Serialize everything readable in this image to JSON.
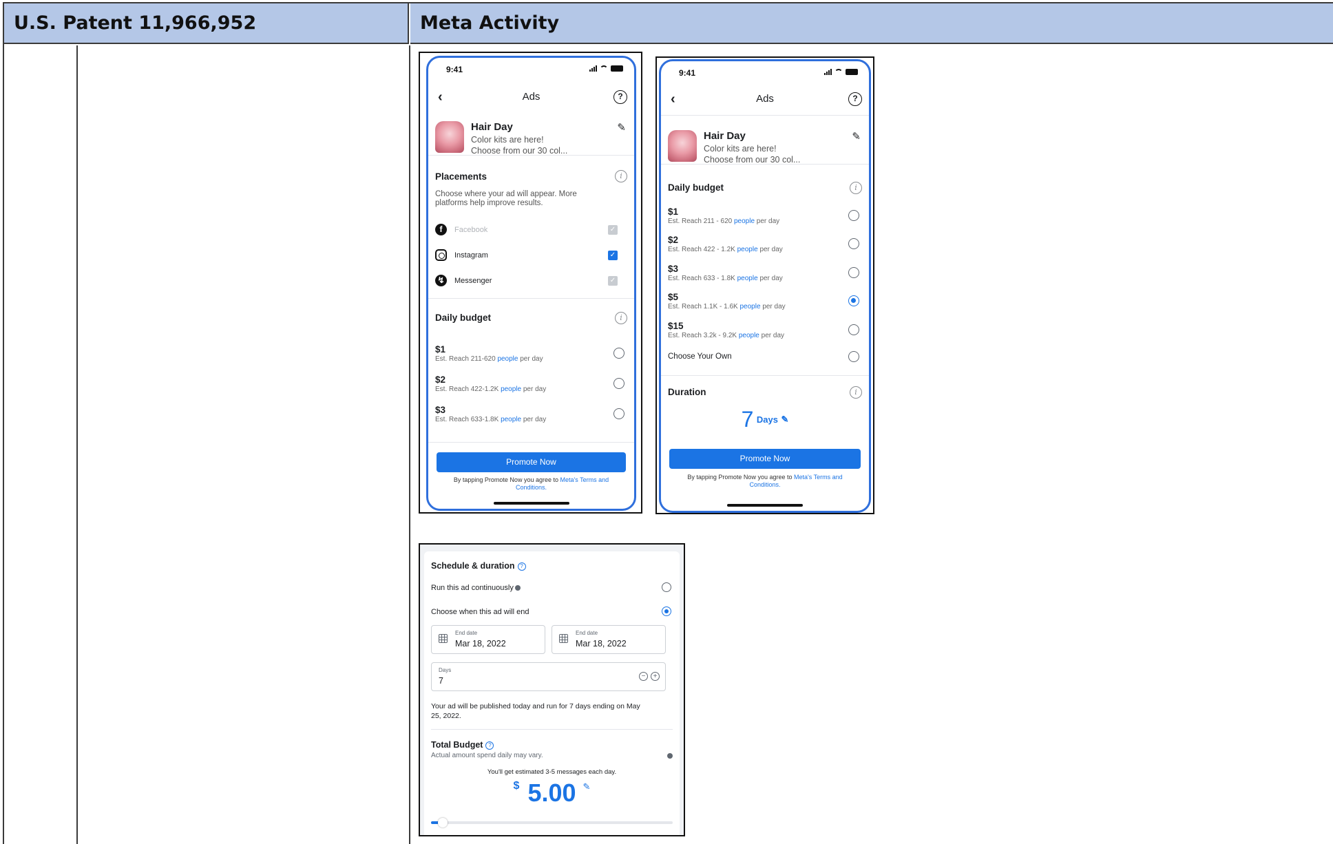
{
  "table": {
    "col_left_header": "U.S. Patent 11,966,952",
    "col_right_header": "Meta Activity"
  },
  "phone1": {
    "time": "9:41",
    "nav_title": "Ads",
    "ad": {
      "title": "Hair Day",
      "line1": "Color kits are here!",
      "line2": "Choose from our 30 col..."
    },
    "placements": {
      "title": "Placements",
      "subtitle_line1": "Choose where your ad will appear. More",
      "subtitle_line2": "platforms help improve results.",
      "items": [
        {
          "label": "Facebook",
          "checked": true,
          "disabled": true
        },
        {
          "label": "Instagram",
          "checked": true,
          "disabled": false
        },
        {
          "label": "Messenger",
          "checked": true,
          "disabled": true
        }
      ]
    },
    "budget": {
      "title": "Daily budget",
      "options": [
        {
          "amount": "$1",
          "reach_prefix": "Est. Reach 211-620",
          "reach_link": "people",
          "reach_suffix": "per day",
          "selected": false
        },
        {
          "amount": "$2",
          "reach_prefix": "Est. Reach 422-1.2K",
          "reach_link": "people",
          "reach_suffix": "per day",
          "selected": false
        },
        {
          "amount": "$3",
          "reach_prefix": "Est. Reach 633-1.8K",
          "reach_link": "people",
          "reach_suffix": "per day",
          "selected": false
        }
      ]
    },
    "promote_label": "Promote Now",
    "terms_prefix": "By tapping Promote Now you agree to",
    "terms_link_1": "Meta's Terms and",
    "terms_link_2": "Conditions."
  },
  "phone2": {
    "time": "9:41",
    "nav_title": "Ads",
    "ad": {
      "title": "Hair Day",
      "line1": "Color kits are here!",
      "line2": "Choose from our 30 col..."
    },
    "budget": {
      "title": "Daily budget",
      "options": [
        {
          "amount": "$1",
          "reach_prefix": "Est. Reach 211 - 620",
          "reach_link": "people",
          "reach_suffix": "per day",
          "selected": false
        },
        {
          "amount": "$2",
          "reach_prefix": "Est. Reach 422 - 1.2K",
          "reach_link": "people",
          "reach_suffix": "per day",
          "selected": false
        },
        {
          "amount": "$3",
          "reach_prefix": "Est. Reach 633 - 1.8K",
          "reach_link": "people",
          "reach_suffix": "per day",
          "selected": false
        },
        {
          "amount": "$5",
          "reach_prefix": "Est. Reach 1.1K - 1.6K",
          "reach_link": "people",
          "reach_suffix": "per day",
          "selected": true
        },
        {
          "amount": "$15",
          "reach_prefix": "Est. Reach 3.2k - 9.2K",
          "reach_link": "people",
          "reach_suffix": "per day",
          "selected": false
        }
      ],
      "choose_own": "Choose Your Own"
    },
    "duration": {
      "title": "Duration",
      "value": "7",
      "unit": "Days"
    },
    "promote_label": "Promote Now",
    "terms_prefix": "By tapping Promote Now you agree to",
    "terms_link_1": "Meta's Terms and",
    "terms_link_2": "Conditions."
  },
  "schedule": {
    "title": "Schedule & duration",
    "run_continuously": "Run this ad continuously",
    "choose_end": "Choose when this ad will end",
    "selected_option": "choose_end",
    "end_date_1_label": "End date",
    "end_date_1_value": "Mar 18, 2022",
    "end_date_2_label": "End date",
    "end_date_2_value": "Mar 18, 2022",
    "days_label": "Days",
    "days_value": "7",
    "description_line1": "Your ad will be published today and run for 7 days ending on May",
    "description_line2": "25, 2022.",
    "total_budget_title": "Total Budget",
    "total_budget_sub": "Actual amount spend daily may vary.",
    "estimate_note": "You'll get estimated 3-5 messages each day.",
    "currency": "$",
    "amount": "5.00",
    "slider_fraction": 0.03
  },
  "colors": {
    "header_bg": "#b4c7e7",
    "accent": "#1b74e4",
    "phone_border": "#2f6fdc"
  }
}
